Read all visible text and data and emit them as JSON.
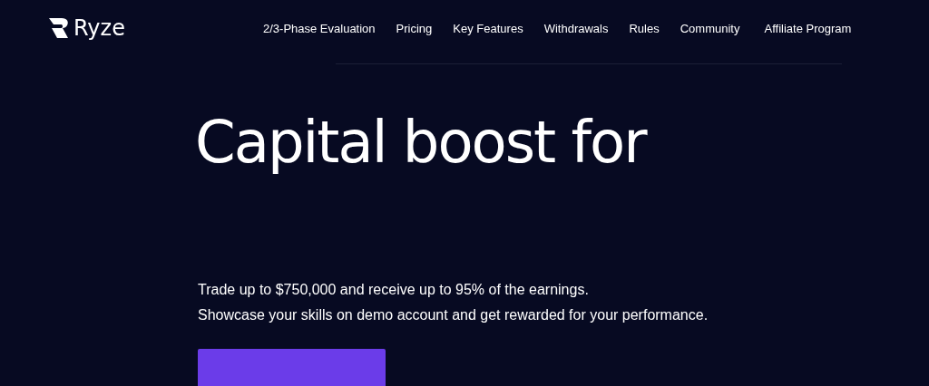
{
  "logo": {
    "text": "Ryze"
  },
  "nav": [
    {
      "label": "2/3-Phase Evaluation"
    },
    {
      "label": "Pricing"
    },
    {
      "label": "Key Features"
    },
    {
      "label": "Withdrawals"
    },
    {
      "label": "Rules"
    },
    {
      "label": "Community"
    },
    {
      "label": "Affiliate Program"
    }
  ],
  "hero": {
    "headline": "Capital boost for",
    "lines": [
      "Trade up to $750,000 and receive up to 95% of the earnings.",
      "Showcase your skills on demo account and get rewarded for your performance."
    ]
  }
}
